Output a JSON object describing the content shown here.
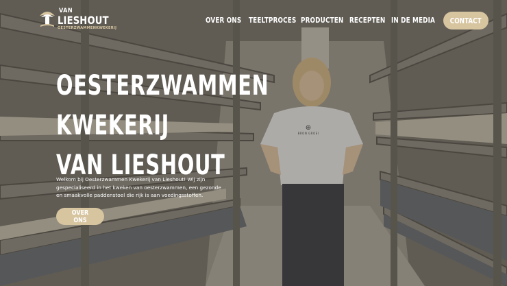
{
  "brand": {
    "van": "VAN",
    "name": "LIESHOUT",
    "tagline": "OESTERZWAMMENKWEKERIJ"
  },
  "nav": {
    "items": [
      {
        "label": "OVER ONS"
      },
      {
        "label": "TEELTPROCES"
      },
      {
        "label": "PRODUCTEN"
      },
      {
        "label": "RECEPTEN"
      },
      {
        "label": "IN DE MEDIA"
      }
    ],
    "cta": "CONTACT"
  },
  "hero": {
    "title_line1": "OESTERZWAMMEN",
    "title_line2": "KWEKERIJ",
    "title_line3": "VAN LIESHOUT",
    "intro": "Welkom bij Oesterzwammen Kwekerij van Lieshout! Wij zijn gespecialiseerd in het kweken van oesterzwammen, een gezonde en smaakvolle paddenstoel die rijk is aan voedingsstoffen.",
    "button": "OVER ONS",
    "shirt_text": "BRON GROEI"
  },
  "colors": {
    "accent": "#d7c5a0",
    "overlay": "#28241e"
  }
}
